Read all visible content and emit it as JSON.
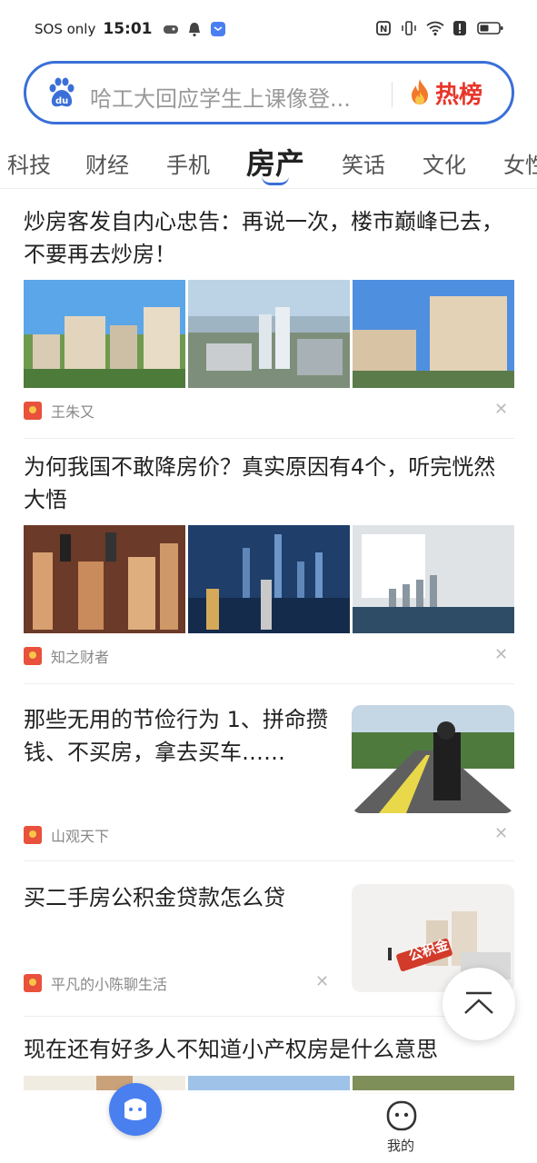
{
  "status_bar": {
    "carrier": "SOS only",
    "time": "15:01"
  },
  "search": {
    "placeholder": "哈工大回应学生上课像登...",
    "hot_label": "热榜",
    "logo_icon": "baidu-paw-icon"
  },
  "tabs": [
    {
      "label": "科技"
    },
    {
      "label": "财经"
    },
    {
      "label": "手机"
    },
    {
      "label": "房产",
      "active": true
    },
    {
      "label": "笑话"
    },
    {
      "label": "文化"
    },
    {
      "label": "女性"
    }
  ],
  "feed": [
    {
      "title": "炒房客发自内心忠告：再说一次，楼市巅峰已去，不要再去炒房！",
      "source": "王朱又",
      "images": 3
    },
    {
      "title": "为何我国不敢降房价？真实原因有4个，听完恍然大悟",
      "source": "知之财者",
      "images": 3
    },
    {
      "title": "那些无用的节俭行为 1、拼命攒钱、不买房，拿去买车……",
      "source": "山观天下",
      "images": 1
    },
    {
      "title": "买二手房公积金贷款怎么贷",
      "source": "平凡的小陈聊生活",
      "images": 1,
      "image_caption": "公积金"
    },
    {
      "title": "现在还有好多人不知道小产权房是什么意思",
      "images": 3
    }
  ],
  "bottom_nav": {
    "mine_label": "我的"
  },
  "colors": {
    "accent": "#3a6fd8",
    "hot": "#e8362a",
    "source_icon": "#e8513b"
  }
}
